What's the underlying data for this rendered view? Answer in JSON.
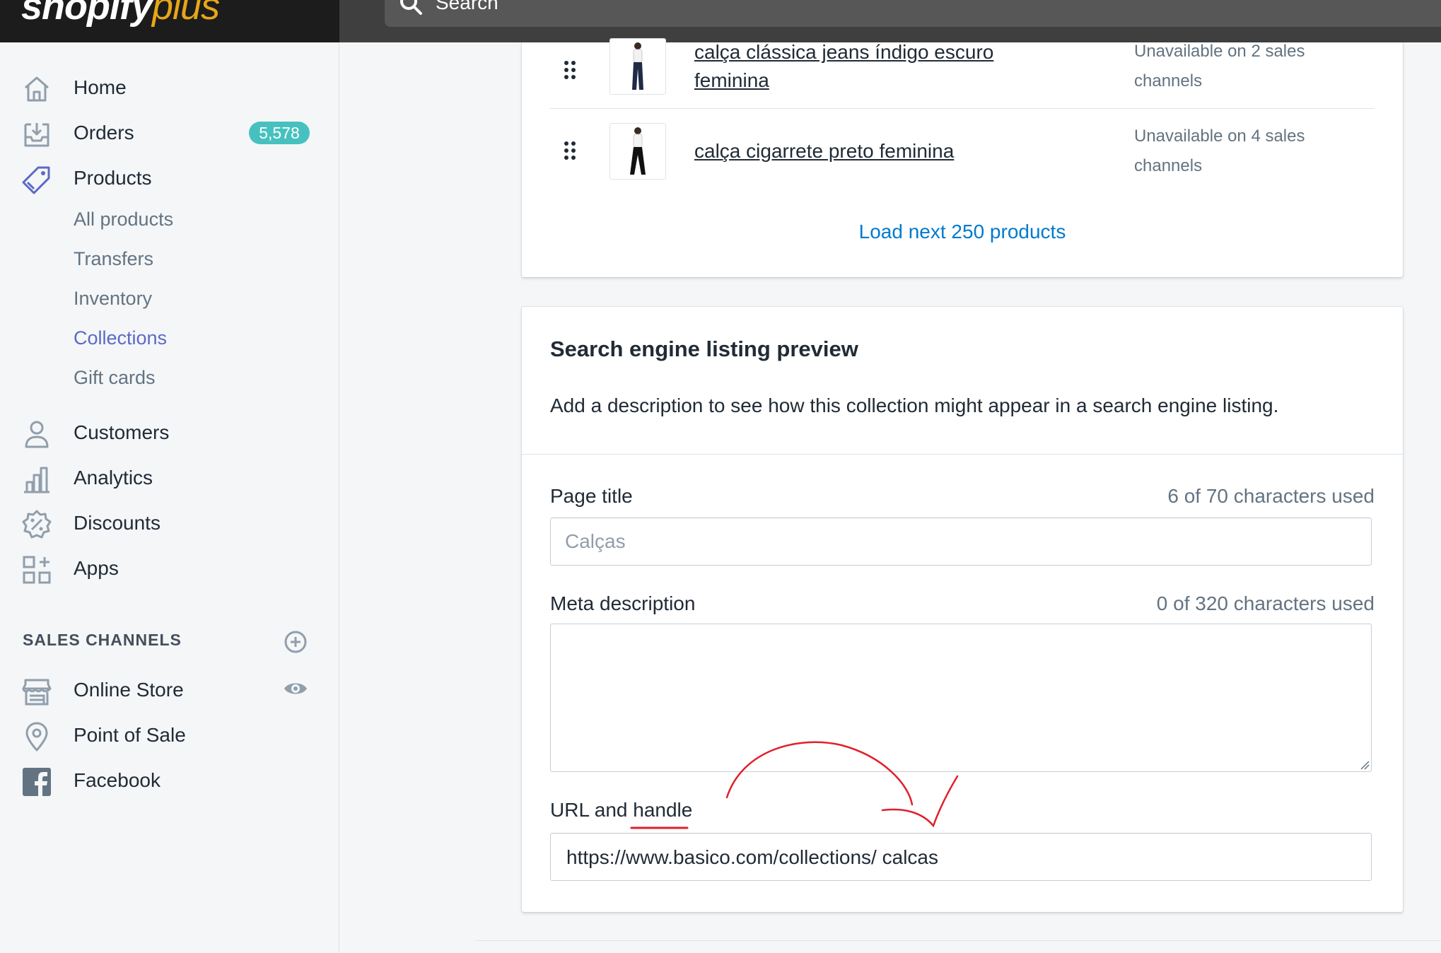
{
  "brand": {
    "name": "shopify",
    "suffix": "plus"
  },
  "search": {
    "placeholder": "Search"
  },
  "sidebar": {
    "items": [
      {
        "label": "Home",
        "icon": "home-icon"
      },
      {
        "label": "Orders",
        "icon": "orders-icon",
        "badge": "5,578"
      },
      {
        "label": "Products",
        "icon": "tag-icon"
      },
      {
        "label": "Customers",
        "icon": "person-icon"
      },
      {
        "label": "Analytics",
        "icon": "bar-chart-icon"
      },
      {
        "label": "Discounts",
        "icon": "discount-icon"
      },
      {
        "label": "Apps",
        "icon": "apps-icon"
      }
    ],
    "products_sub": [
      "All products",
      "Transfers",
      "Inventory",
      "Collections",
      "Gift cards"
    ],
    "sales_channels": {
      "heading": "SALES CHANNELS",
      "items": [
        {
          "label": "Online Store",
          "icon": "store-icon"
        },
        {
          "label": "Point of Sale",
          "icon": "location-pin-icon"
        },
        {
          "label": "Facebook",
          "icon": "facebook-icon"
        }
      ]
    }
  },
  "products": {
    "rows": [
      {
        "name": "calça clássica jeans índigo escuro feminina",
        "status": "Unavailable on 2 sales channels"
      },
      {
        "name": "calça cigarrete preto feminina",
        "status": "Unavailable on 4 sales channels"
      }
    ],
    "load_next": "Load next 250 products"
  },
  "seo": {
    "title": "Search engine listing preview",
    "description": "Add a description to see how this collection might appear in a search engine listing.",
    "page_title": {
      "label": "Page title",
      "count": "6 of 70 characters used",
      "placeholder": "Calças"
    },
    "meta_description": {
      "label": "Meta description",
      "count": "0 of 320 characters used",
      "value": ""
    },
    "url_handle": {
      "label": "URL and handle",
      "value": "https://www.basico.com/collections/ calcas"
    }
  },
  "colors": {
    "accent": "#5c6ac4",
    "link": "#007ace",
    "badge": "#47c1bf",
    "annotation": "#e0202a"
  }
}
